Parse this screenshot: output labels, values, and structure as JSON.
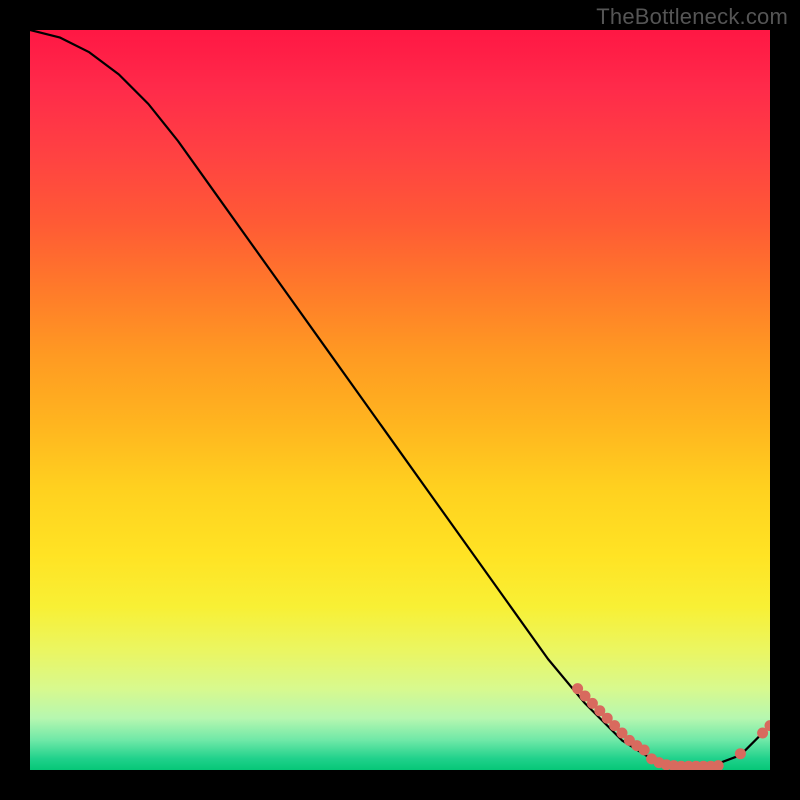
{
  "watermark": "TheBottleneck.com",
  "chart_data": {
    "type": "line",
    "title": "",
    "xlabel": "",
    "ylabel": "",
    "xlim": [
      0,
      100
    ],
    "ylim": [
      0,
      100
    ],
    "grid": false,
    "legend": false,
    "series": [
      {
        "name": "curve",
        "x": [
          0,
          4,
          8,
          12,
          16,
          20,
          25,
          30,
          35,
          40,
          45,
          50,
          55,
          60,
          65,
          70,
          75,
          80,
          84,
          88,
          92,
          96,
          100
        ],
        "y": [
          100,
          99,
          97,
          94,
          90,
          85,
          78,
          71,
          64,
          57,
          50,
          43,
          36,
          29,
          22,
          15,
          9,
          4,
          1.5,
          0.5,
          0.5,
          2,
          6
        ]
      }
    ],
    "markers": [
      {
        "x": 74,
        "y": 11
      },
      {
        "x": 75,
        "y": 10
      },
      {
        "x": 76,
        "y": 9
      },
      {
        "x": 77,
        "y": 8
      },
      {
        "x": 78,
        "y": 7
      },
      {
        "x": 79,
        "y": 6
      },
      {
        "x": 80,
        "y": 5
      },
      {
        "x": 81,
        "y": 4
      },
      {
        "x": 82,
        "y": 3.3
      },
      {
        "x": 83,
        "y": 2.7
      },
      {
        "x": 84,
        "y": 1.5
      },
      {
        "x": 85,
        "y": 1.0
      },
      {
        "x": 86,
        "y": 0.7
      },
      {
        "x": 87,
        "y": 0.6
      },
      {
        "x": 88,
        "y": 0.5
      },
      {
        "x": 89,
        "y": 0.5
      },
      {
        "x": 90,
        "y": 0.5
      },
      {
        "x": 91,
        "y": 0.5
      },
      {
        "x": 92,
        "y": 0.5
      },
      {
        "x": 93,
        "y": 0.6
      },
      {
        "x": 96,
        "y": 2.2
      },
      {
        "x": 99,
        "y": 5.0
      },
      {
        "x": 100,
        "y": 6.0
      }
    ],
    "marker_color": "#d86a5e",
    "curve_color": "#000000"
  }
}
